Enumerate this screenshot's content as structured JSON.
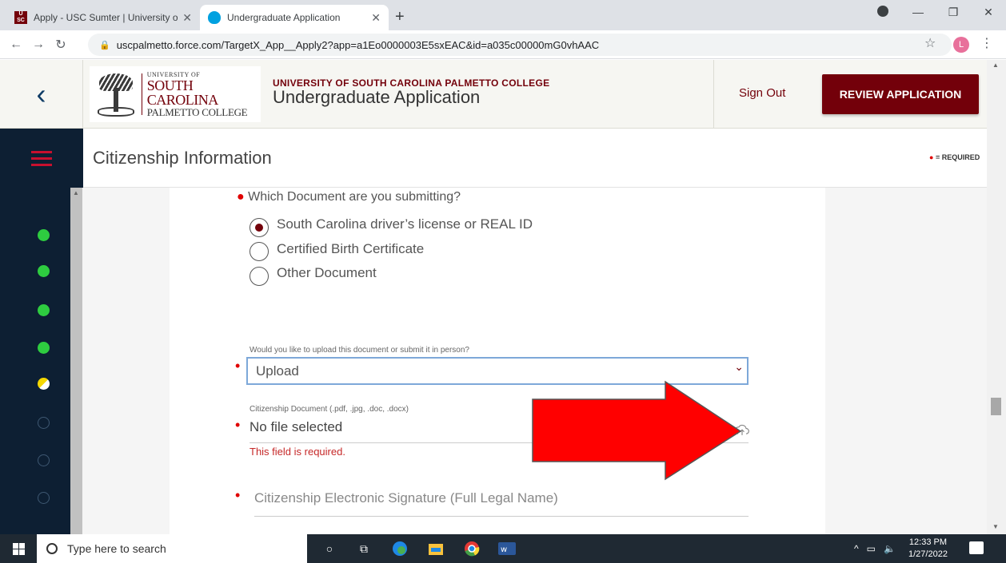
{
  "browser": {
    "tabs": [
      {
        "title": "Apply - USC Sumter | University o",
        "favicon": "usc-favicon-icon",
        "active": false
      },
      {
        "title": "Undergraduate Application",
        "favicon": "salesforce-cloud-icon",
        "active": true
      }
    ],
    "new_tab": "+",
    "url": "uscpalmetto.force.com/TargetX_App__Apply2?app=a1Eo0000003E5sxEAC&id=a035c00000mG0vhAAC",
    "profile_initial": "L"
  },
  "header": {
    "logo": {
      "line1": "UNIVERSITY OF",
      "line2": "SOUTH CAROLINA",
      "line3": "PALMETTO COLLEGE"
    },
    "subtitle": "UNIVERSITY OF SOUTH CAROLINA PALMETTO COLLEGE",
    "title": "Undergraduate Application",
    "sign_out": "Sign Out",
    "review_button": "REVIEW APPLICATION",
    "accent_color": "#73000a"
  },
  "section": {
    "title": "Citizenship Information",
    "required_key": "= REQUIRED"
  },
  "steps": [
    {
      "status": "done"
    },
    {
      "status": "done"
    },
    {
      "status": "done"
    },
    {
      "status": "done"
    },
    {
      "status": "current"
    },
    {
      "status": "todo"
    },
    {
      "status": "todo"
    },
    {
      "status": "todo"
    }
  ],
  "form": {
    "document_question": "Which Document are you submitting?",
    "document_options": [
      {
        "label": "South Carolina driver’s license or REAL ID",
        "selected": true
      },
      {
        "label": "Certified Birth Certificate",
        "selected": false
      },
      {
        "label": "Other Document",
        "selected": false
      }
    ],
    "upload_question": "Would you like to upload this document or submit it in person?",
    "upload_value": "Upload",
    "file_label": "Citizenship Document (.pdf, .jpg, .doc, .docx)",
    "file_value": "No file selected",
    "file_error": "This field is required.",
    "signature_placeholder": "Citizenship Electronic Signature (Full Legal Name)"
  },
  "taskbar": {
    "search_placeholder": "Type here to search",
    "time": "12:33 PM",
    "date": "1/27/2022"
  }
}
